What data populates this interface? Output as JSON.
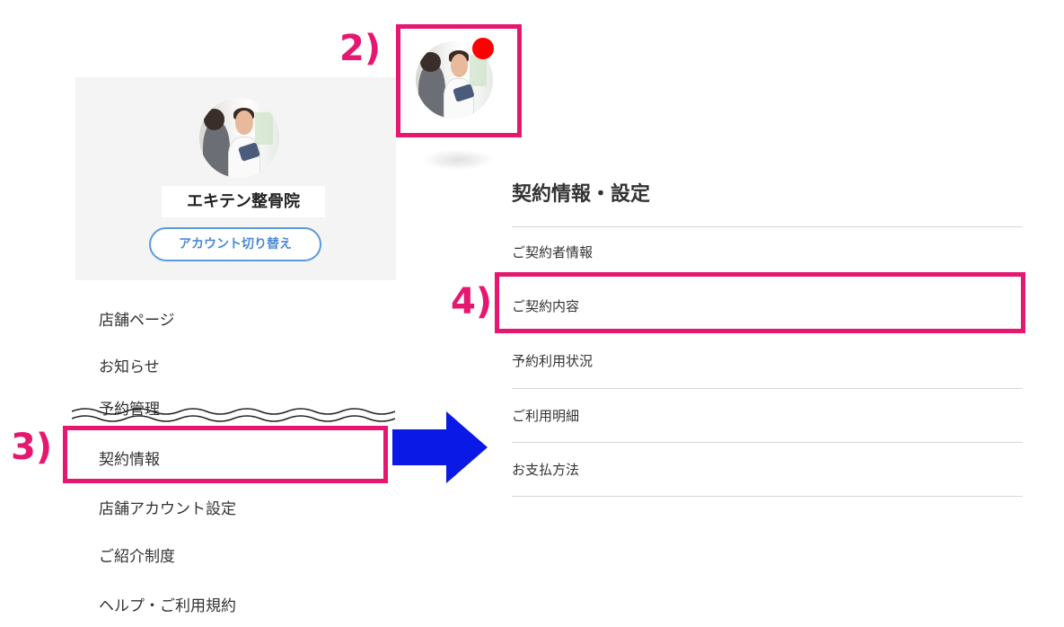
{
  "steps": {
    "s2": "2)",
    "s3": "3)",
    "s4": "4)"
  },
  "profile": {
    "shop_name": "エキテン整骨院",
    "switch_account": "アカウント切り替え"
  },
  "sidebar": {
    "items": [
      "店舗ページ",
      "お知らせ",
      "予約管理",
      "契約情報",
      "店舗アカウント設定",
      "ご紹介制度",
      "ヘルプ・ご利用規約"
    ]
  },
  "panel": {
    "title": "契約情報・設定",
    "items": [
      "ご契約者情報",
      "ご契約内容",
      "予約利用状況",
      "ご利用明細",
      "お支払方法"
    ]
  },
  "colors": {
    "highlight": "#e6176f",
    "arrow": "#0a19e6",
    "notification": "#ff0000",
    "button_border": "#5a9be0"
  },
  "icons": {
    "arrow": "arrow-right-icon",
    "notification": "notification-dot-icon"
  }
}
